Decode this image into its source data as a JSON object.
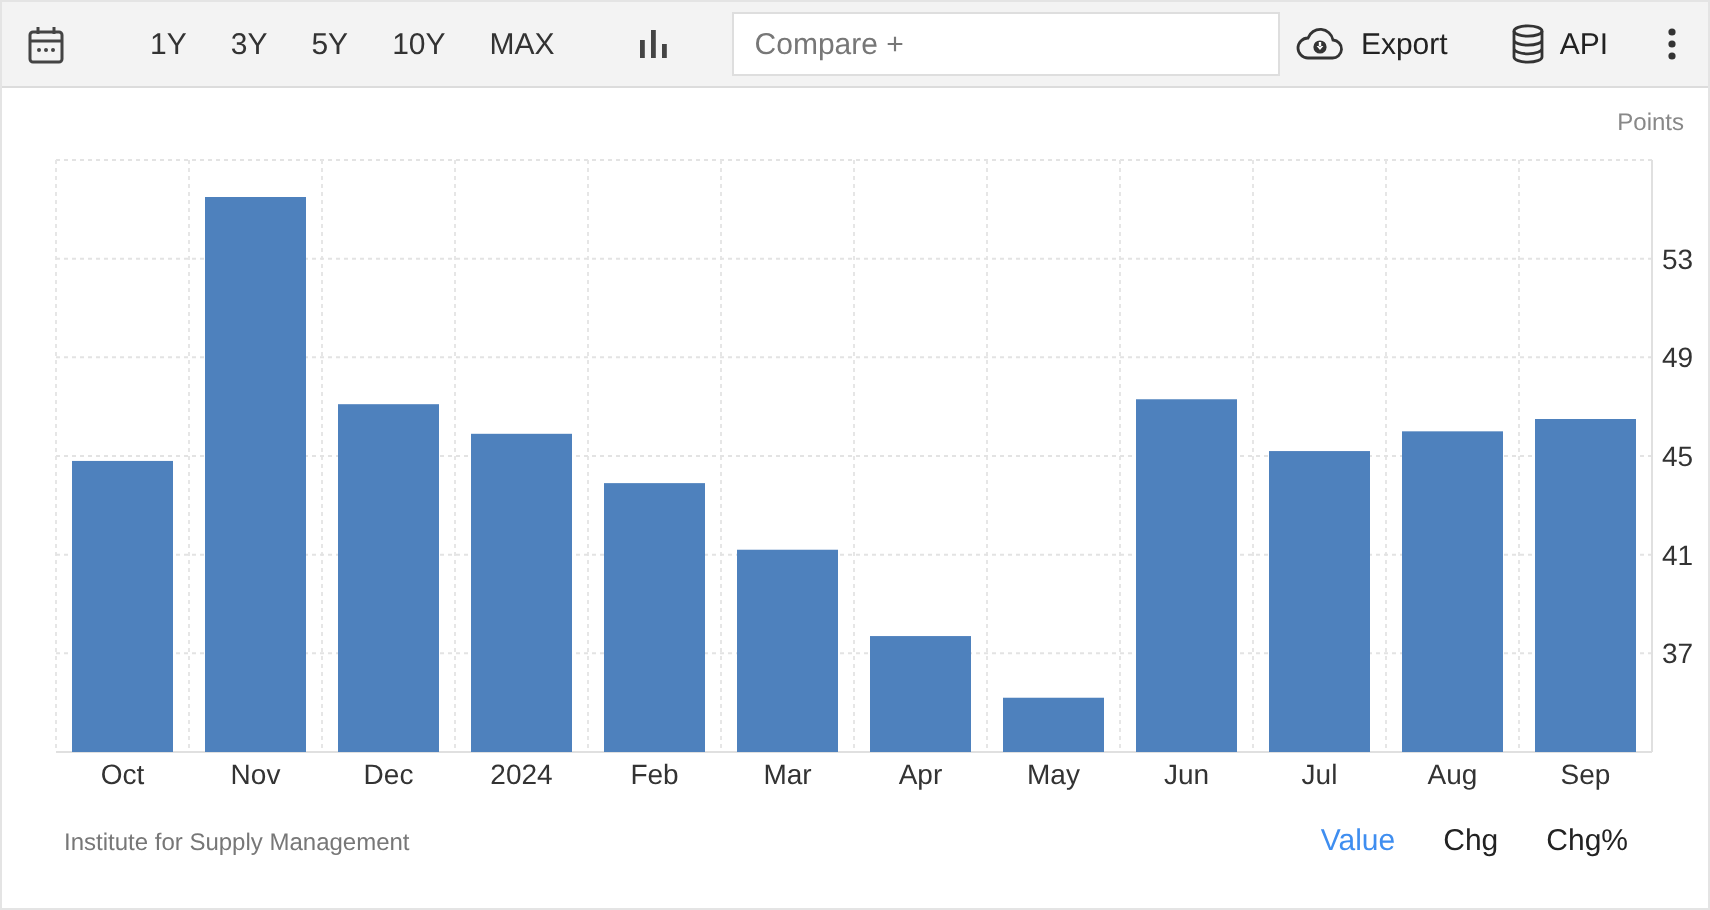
{
  "toolbar": {
    "ranges": [
      "1Y",
      "3Y",
      "5Y",
      "10Y",
      "MAX"
    ],
    "compare": {
      "placeholder": "Compare +"
    },
    "export": "Export",
    "api": "API"
  },
  "chart": {
    "chart_data": {
      "type": "bar",
      "grid": true,
      "categories": [
        "Oct",
        "Nov",
        "Dec",
        "2024",
        "Feb",
        "Mar",
        "Apr",
        "May",
        "Jun",
        "Jul",
        "Aug",
        "Sep"
      ],
      "series": [
        {
          "name": "Points",
          "color": "#4e81bd",
          "values": [
            44.8,
            55.5,
            47.1,
            45.9,
            43.9,
            41.2,
            37.7,
            35.2,
            47.3,
            45.2,
            46.0,
            46.5
          ]
        }
      ],
      "ylim": [
        33,
        57
      ],
      "yticks": [
        37,
        41,
        45,
        49,
        53
      ]
    }
  },
  "footer": {
    "source": "Institute for Supply Management",
    "modes": [
      {
        "label": "Value",
        "selected": true
      },
      {
        "label": "Chg",
        "selected": false
      },
      {
        "label": "Chg%",
        "selected": false
      }
    ]
  }
}
